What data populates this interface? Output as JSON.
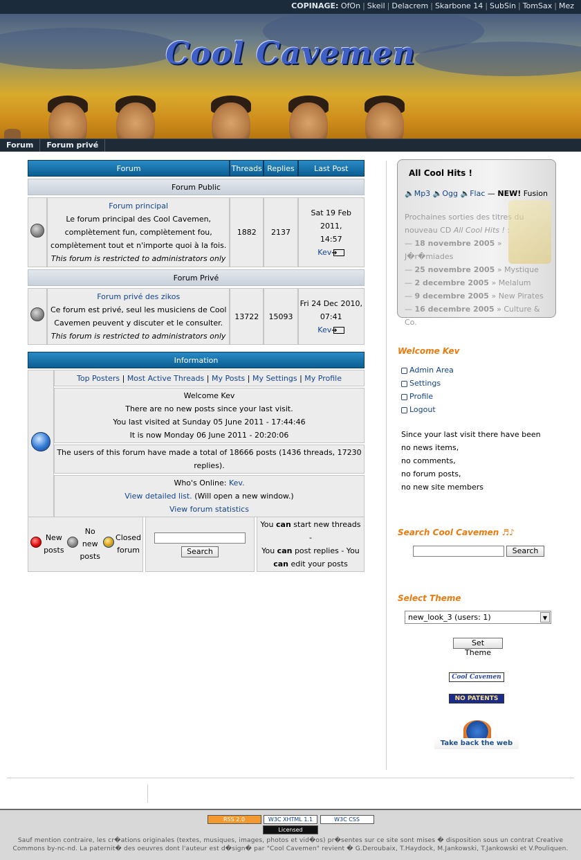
{
  "topbar": {
    "label": "COPINAGE:",
    "links": [
      "OfOn",
      "Skeil",
      "Delacrem",
      "Skarbone 14",
      "SubSin",
      "TomSax",
      "Mez"
    ]
  },
  "banner": {
    "title": "Cool Cavemen"
  },
  "nav": {
    "items": [
      "Forum",
      "Forum privé"
    ]
  },
  "forum_table": {
    "headers": {
      "forum": "Forum",
      "threads": "Threads",
      "replies": "Replies",
      "last_post": "Last Post"
    },
    "categories": [
      {
        "name": "Forum Public",
        "forums": [
          {
            "title": "Forum principal",
            "desc": "Le forum principal des Cool Cavemen, complètement fun, complètement fou, complètement tout et n'importe quoi à la fois.",
            "note": "This forum is restricted to administrators only",
            "threads": "1882",
            "replies": "2137",
            "last_date": "Sat 19 Feb 2011,",
            "last_time": "14:57",
            "last_user": "Kev"
          }
        ]
      },
      {
        "name": "Forum Privé",
        "forums": [
          {
            "title": "Forum privé des zikos",
            "desc": "Ce forum est privé, seul les musiciens de Cool Cavemen peuvent y discuter et le consulter.",
            "note": "This forum is restricted to administrators only",
            "threads": "13722",
            "replies": "15093",
            "last_date": "Fri 24 Dec 2010,",
            "last_time": "07:41",
            "last_user": "Kev"
          }
        ]
      }
    ]
  },
  "info": {
    "header": "Information",
    "links": [
      "Top Posters",
      "Most Active Threads",
      "My Posts",
      "My Settings",
      "My Profile"
    ],
    "welcome": "Welcome Kev",
    "no_new": "There are no new posts since your last visit.",
    "last_visit": "You last visited at Sunday 05 June 2011 - 17:44:46",
    "now": "It is now Monday 06 June 2011 - 20:20:06",
    "totals": "The users of this forum have made a total of 18666 posts (1436 threads, 17230 replies).",
    "online_label": "Who's Online:",
    "online_user": "Kev.",
    "detailed_link": "View detailed list.",
    "detailed_note": "(Will open a new window.)",
    "stats_link": "View forum statistics"
  },
  "legend": {
    "new_posts": "New posts",
    "no_new_posts": "No new posts",
    "closed_forum": "Closed forum",
    "search_button": "Search",
    "perm_can": "can",
    "perm_1a": "You",
    "perm_1b": "start new threads -",
    "perm_2a": "You",
    "perm_2b": "post replies - You",
    "perm_3b": "edit your posts"
  },
  "hits": {
    "title": "All Cool Hits !",
    "formats": [
      "Mp3",
      "Ogg",
      "Flac"
    ],
    "new_label": "NEW!",
    "new_title": "Fusion",
    "upcoming_intro": "Prochaines sorties des titres du nouveau CD",
    "upcoming_cd": "All Cool Hits !",
    "releases": [
      {
        "date": "18 novembre 2005",
        "title": "J�r�miades"
      },
      {
        "date": "25 novembre 2005",
        "title": "Mystique"
      },
      {
        "date": "2 decembre 2005",
        "title": "Melalum"
      },
      {
        "date": "9 decembre 2005",
        "title": "New Pirates"
      },
      {
        "date": "16 decembre 2005",
        "title": "Culture & Co."
      }
    ]
  },
  "welcome_box": {
    "title": "Welcome Kev",
    "links": [
      "Admin Area",
      "Settings",
      "Profile",
      "Logout"
    ],
    "since": "Since your last visit there have been",
    "lines": [
      "no news items,",
      "no comments,",
      "no forum posts,",
      "no new site members"
    ]
  },
  "site_search": {
    "title": "Search Cool Cavemen ♬♪",
    "button": "Search"
  },
  "theme": {
    "title": "Select Theme",
    "selected": "new_look_3 (users: 1)",
    "button": "Set Theme"
  },
  "badges": {
    "cool": "Cool Cavemen",
    "nopatents": "NO PATENTS",
    "firefox": "Take back the web"
  },
  "footer": {
    "badges": [
      "RSS 2.0",
      "W3C XHTML 1.1",
      "W3C CSS",
      "Licensed"
    ],
    "legal": "Sauf mention contraire, les cr�ations originales (textes, musiques, images, photos et vid�os) pr�sentes sur ce site sont mises � disposition sous un contrat Creative Commons by-nc-nd. La paternit� des oeuvres dont l'auteur est d�sign� par \"Cool Cavemen\" revient � G.Deroubaix, T.Haydock, M.Jankowski, T.Jankowski et V.Pouliquen."
  },
  "colors": {
    "header_blue": "#0b5e92",
    "accent_orange": "#e87b10",
    "link_blue": "#13438e"
  }
}
